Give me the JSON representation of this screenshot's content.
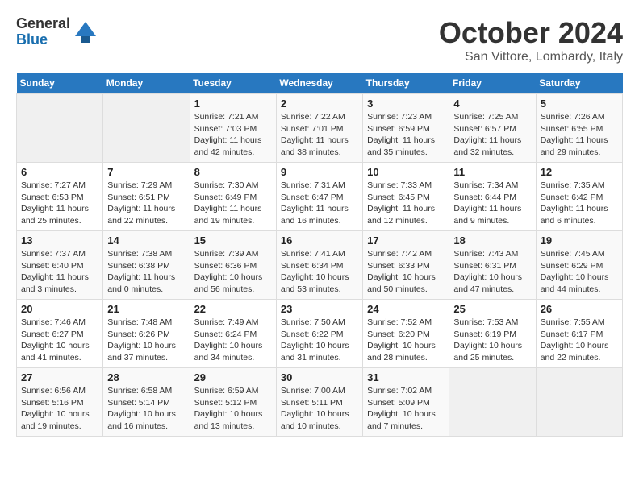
{
  "logo": {
    "general": "General",
    "blue": "Blue"
  },
  "title": "October 2024",
  "location": "San Vittore, Lombardy, Italy",
  "headers": [
    "Sunday",
    "Monday",
    "Tuesday",
    "Wednesday",
    "Thursday",
    "Friday",
    "Saturday"
  ],
  "weeks": [
    [
      {
        "day": "",
        "sunrise": "",
        "sunset": "",
        "daylight": ""
      },
      {
        "day": "",
        "sunrise": "",
        "sunset": "",
        "daylight": ""
      },
      {
        "day": "1",
        "sunrise": "Sunrise: 7:21 AM",
        "sunset": "Sunset: 7:03 PM",
        "daylight": "Daylight: 11 hours and 42 minutes."
      },
      {
        "day": "2",
        "sunrise": "Sunrise: 7:22 AM",
        "sunset": "Sunset: 7:01 PM",
        "daylight": "Daylight: 11 hours and 38 minutes."
      },
      {
        "day": "3",
        "sunrise": "Sunrise: 7:23 AM",
        "sunset": "Sunset: 6:59 PM",
        "daylight": "Daylight: 11 hours and 35 minutes."
      },
      {
        "day": "4",
        "sunrise": "Sunrise: 7:25 AM",
        "sunset": "Sunset: 6:57 PM",
        "daylight": "Daylight: 11 hours and 32 minutes."
      },
      {
        "day": "5",
        "sunrise": "Sunrise: 7:26 AM",
        "sunset": "Sunset: 6:55 PM",
        "daylight": "Daylight: 11 hours and 29 minutes."
      }
    ],
    [
      {
        "day": "6",
        "sunrise": "Sunrise: 7:27 AM",
        "sunset": "Sunset: 6:53 PM",
        "daylight": "Daylight: 11 hours and 25 minutes."
      },
      {
        "day": "7",
        "sunrise": "Sunrise: 7:29 AM",
        "sunset": "Sunset: 6:51 PM",
        "daylight": "Daylight: 11 hours and 22 minutes."
      },
      {
        "day": "8",
        "sunrise": "Sunrise: 7:30 AM",
        "sunset": "Sunset: 6:49 PM",
        "daylight": "Daylight: 11 hours and 19 minutes."
      },
      {
        "day": "9",
        "sunrise": "Sunrise: 7:31 AM",
        "sunset": "Sunset: 6:47 PM",
        "daylight": "Daylight: 11 hours and 16 minutes."
      },
      {
        "day": "10",
        "sunrise": "Sunrise: 7:33 AM",
        "sunset": "Sunset: 6:45 PM",
        "daylight": "Daylight: 11 hours and 12 minutes."
      },
      {
        "day": "11",
        "sunrise": "Sunrise: 7:34 AM",
        "sunset": "Sunset: 6:44 PM",
        "daylight": "Daylight: 11 hours and 9 minutes."
      },
      {
        "day": "12",
        "sunrise": "Sunrise: 7:35 AM",
        "sunset": "Sunset: 6:42 PM",
        "daylight": "Daylight: 11 hours and 6 minutes."
      }
    ],
    [
      {
        "day": "13",
        "sunrise": "Sunrise: 7:37 AM",
        "sunset": "Sunset: 6:40 PM",
        "daylight": "Daylight: 11 hours and 3 minutes."
      },
      {
        "day": "14",
        "sunrise": "Sunrise: 7:38 AM",
        "sunset": "Sunset: 6:38 PM",
        "daylight": "Daylight: 11 hours and 0 minutes."
      },
      {
        "day": "15",
        "sunrise": "Sunrise: 7:39 AM",
        "sunset": "Sunset: 6:36 PM",
        "daylight": "Daylight: 10 hours and 56 minutes."
      },
      {
        "day": "16",
        "sunrise": "Sunrise: 7:41 AM",
        "sunset": "Sunset: 6:34 PM",
        "daylight": "Daylight: 10 hours and 53 minutes."
      },
      {
        "day": "17",
        "sunrise": "Sunrise: 7:42 AM",
        "sunset": "Sunset: 6:33 PM",
        "daylight": "Daylight: 10 hours and 50 minutes."
      },
      {
        "day": "18",
        "sunrise": "Sunrise: 7:43 AM",
        "sunset": "Sunset: 6:31 PM",
        "daylight": "Daylight: 10 hours and 47 minutes."
      },
      {
        "day": "19",
        "sunrise": "Sunrise: 7:45 AM",
        "sunset": "Sunset: 6:29 PM",
        "daylight": "Daylight: 10 hours and 44 minutes."
      }
    ],
    [
      {
        "day": "20",
        "sunrise": "Sunrise: 7:46 AM",
        "sunset": "Sunset: 6:27 PM",
        "daylight": "Daylight: 10 hours and 41 minutes."
      },
      {
        "day": "21",
        "sunrise": "Sunrise: 7:48 AM",
        "sunset": "Sunset: 6:26 PM",
        "daylight": "Daylight: 10 hours and 37 minutes."
      },
      {
        "day": "22",
        "sunrise": "Sunrise: 7:49 AM",
        "sunset": "Sunset: 6:24 PM",
        "daylight": "Daylight: 10 hours and 34 minutes."
      },
      {
        "day": "23",
        "sunrise": "Sunrise: 7:50 AM",
        "sunset": "Sunset: 6:22 PM",
        "daylight": "Daylight: 10 hours and 31 minutes."
      },
      {
        "day": "24",
        "sunrise": "Sunrise: 7:52 AM",
        "sunset": "Sunset: 6:20 PM",
        "daylight": "Daylight: 10 hours and 28 minutes."
      },
      {
        "day": "25",
        "sunrise": "Sunrise: 7:53 AM",
        "sunset": "Sunset: 6:19 PM",
        "daylight": "Daylight: 10 hours and 25 minutes."
      },
      {
        "day": "26",
        "sunrise": "Sunrise: 7:55 AM",
        "sunset": "Sunset: 6:17 PM",
        "daylight": "Daylight: 10 hours and 22 minutes."
      }
    ],
    [
      {
        "day": "27",
        "sunrise": "Sunrise: 6:56 AM",
        "sunset": "Sunset: 5:16 PM",
        "daylight": "Daylight: 10 hours and 19 minutes."
      },
      {
        "day": "28",
        "sunrise": "Sunrise: 6:58 AM",
        "sunset": "Sunset: 5:14 PM",
        "daylight": "Daylight: 10 hours and 16 minutes."
      },
      {
        "day": "29",
        "sunrise": "Sunrise: 6:59 AM",
        "sunset": "Sunset: 5:12 PM",
        "daylight": "Daylight: 10 hours and 13 minutes."
      },
      {
        "day": "30",
        "sunrise": "Sunrise: 7:00 AM",
        "sunset": "Sunset: 5:11 PM",
        "daylight": "Daylight: 10 hours and 10 minutes."
      },
      {
        "day": "31",
        "sunrise": "Sunrise: 7:02 AM",
        "sunset": "Sunset: 5:09 PM",
        "daylight": "Daylight: 10 hours and 7 minutes."
      },
      {
        "day": "",
        "sunrise": "",
        "sunset": "",
        "daylight": ""
      },
      {
        "day": "",
        "sunrise": "",
        "sunset": "",
        "daylight": ""
      }
    ]
  ]
}
